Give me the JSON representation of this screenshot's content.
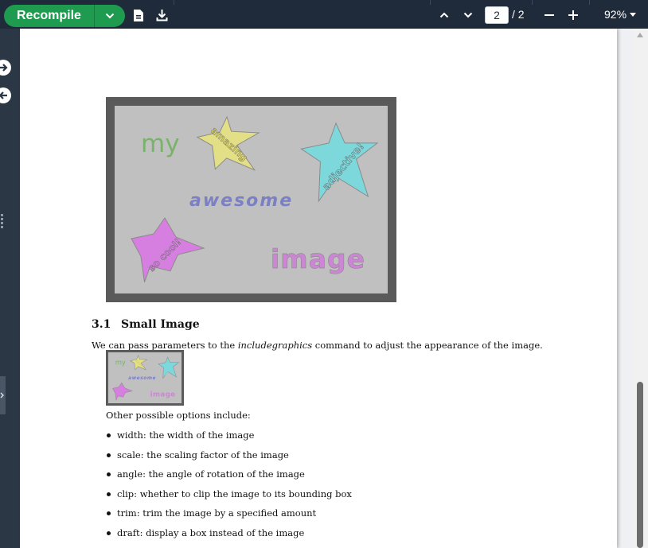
{
  "toolbar": {
    "recompile_label": "Recompile",
    "page_current": "2",
    "page_total": "/ 2",
    "zoom_label": "92%"
  },
  "image": {
    "words": {
      "my": "my",
      "amazing": "amazing",
      "adjective": "adjective!",
      "awesome": "awesome",
      "so_cool": "so cool!",
      "image": "image"
    }
  },
  "document": {
    "section_number": "3.1",
    "section_title": "Small Image",
    "paragraph_before": "We can pass parameters to the ",
    "paragraph_em": "includegraphics",
    "paragraph_after": " command to adjust the appearance of the image.",
    "options_intro": "Other possible options include:",
    "options": [
      "width: the width of the image",
      "scale: the scaling factor of the image",
      "angle: the angle of rotation of the image",
      "clip: whether to clip the image to its bounding box",
      "trim: trim the image by a specified amount",
      "draft: display a box instead of the image"
    ]
  },
  "colors": {
    "toolbar_bg": "#1f2b3b",
    "recompile_green": "#1e9b4f",
    "image_frame": "#5a5a5a",
    "image_bg": "#c0c0c0",
    "star_yellow": "#e3df86",
    "star_cyan": "#7dd8dc",
    "star_magenta": "#d77fe0",
    "text_green": "#79b36b",
    "text_blue": "#7a80c3",
    "text_pink": "#cd86d6"
  }
}
